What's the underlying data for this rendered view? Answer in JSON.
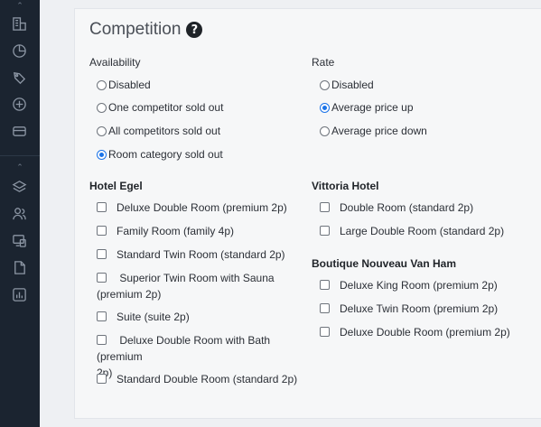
{
  "panel": {
    "title": "Competition",
    "help_glyph": "?"
  },
  "availability": {
    "label": "Availability",
    "options": [
      {
        "label": "Disabled",
        "checked": false
      },
      {
        "label": "One competitor sold out",
        "checked": false
      },
      {
        "label": "All competitors sold out",
        "checked": false
      },
      {
        "label": "Room category sold out",
        "checked": true
      }
    ]
  },
  "rate": {
    "label": "Rate",
    "options": [
      {
        "label": "Disabled",
        "checked": false
      },
      {
        "label": "Average price up",
        "checked": true
      },
      {
        "label": "Average price down",
        "checked": false
      }
    ]
  },
  "hotels": {
    "egel": {
      "name": "Hotel Egel",
      "rooms": [
        "Deluxe Double Room (premium 2p)",
        "Family Room (family 4p)",
        "Standard Twin Room (standard 2p)",
        "Superior Twin Room with Sauna",
        "(premium 2p)",
        "Suite (suite 2p)",
        "Deluxe Double Room with Bath (premium",
        "2p)",
        "Standard Double Room (standard 2p)"
      ]
    },
    "vittoria": {
      "name": "Vittoria Hotel",
      "rooms": [
        "Double Room (standard 2p)",
        "Large Double Room (standard 2p)"
      ]
    },
    "boutique": {
      "name": "Boutique Nouveau Van Ham",
      "rooms": [
        "Deluxe King Room (premium 2p)",
        "Deluxe Twin Room (premium 2p)",
        "Deluxe Double Room (premium 2p)"
      ]
    }
  },
  "sidebar": {
    "icons": [
      "building-icon",
      "chart-pie-icon",
      "tag-icon",
      "plus-circle-icon",
      "card-icon",
      "layers-icon",
      "users-icon",
      "devices-icon",
      "document-icon",
      "report-icon"
    ]
  },
  "colors": {
    "sidebar_bg": "#1b2430",
    "accent": "#1a73e8",
    "panel_bg": "#f6f7f8"
  }
}
